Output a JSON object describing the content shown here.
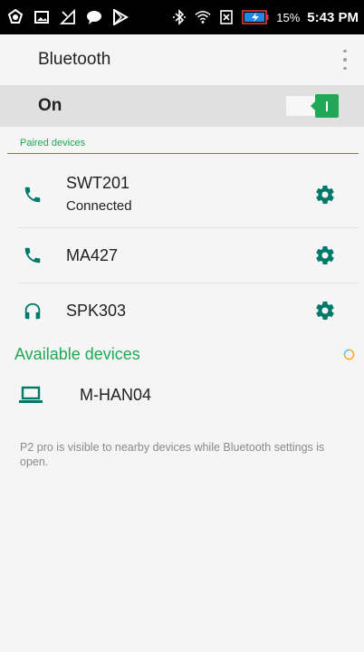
{
  "status_bar": {
    "battery_percent": "15%",
    "time": "5:43 PM",
    "icons_left": [
      "vpn-key-icon",
      "image-icon",
      "signal-off-icon",
      "chat-icon",
      "play-store-icon"
    ],
    "icons_right": [
      "bluetooth-icon",
      "wifi-icon",
      "no-sim-icon",
      "battery-charging-icon"
    ]
  },
  "app_bar": {
    "title": "Bluetooth",
    "overflow_icon": "more-vert-icon"
  },
  "master_switch": {
    "label": "On",
    "state": true,
    "accent_color": "#1fa855"
  },
  "paired": {
    "header": "Paired devices",
    "devices": [
      {
        "name": "SWT201",
        "status": "Connected",
        "icon": "phone-icon"
      },
      {
        "name": "MA427",
        "status": "",
        "icon": "phone-icon"
      },
      {
        "name": "SPK303",
        "status": "",
        "icon": "headset-icon"
      }
    ]
  },
  "available": {
    "header": "Available devices",
    "devices": [
      {
        "name": "M-HAN04",
        "icon": "laptop-icon"
      }
    ]
  },
  "footer": "P2 pro is visible to nearby devices while Bluetooth settings is open.",
  "colors": {
    "accent": "#1fa855",
    "icon": "#00796b",
    "background": "#f5f5f5",
    "switch_bar": "#e0e0e0"
  }
}
